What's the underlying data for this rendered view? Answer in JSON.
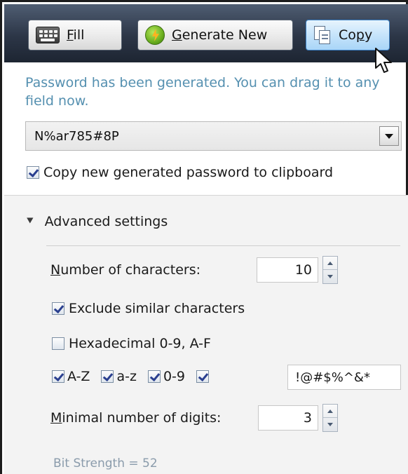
{
  "toolbar": {
    "fill": {
      "label_pre": "",
      "label_ul": "F",
      "label_post": "ill",
      "icon": "keyboard-icon"
    },
    "generate": {
      "label_pre": "",
      "label_ul": "G",
      "label_post": "enerate New",
      "icon": "lightning-icon"
    },
    "copy": {
      "label_pre": "Co",
      "label_ul": "p",
      "label_post": "y",
      "icon": "copy-icon"
    }
  },
  "info_text": "Password has been generated. You can drag it to any field now.",
  "password": {
    "value": "N%ar785#8P"
  },
  "copy_to_clipboard": {
    "label": "Copy new generated password to clipboard",
    "checked": true
  },
  "advanced": {
    "header": "Advanced settings",
    "num_chars": {
      "label_ul": "N",
      "label_rest": "umber of characters:",
      "value": "10"
    },
    "exclude_similar": {
      "label": "Exclude similar characters",
      "checked": true
    },
    "hexadecimal": {
      "label": "Hexadecimal 0-9, A-F",
      "checked": false
    },
    "sets": [
      {
        "label": "A-Z",
        "checked": true
      },
      {
        "label": "a-z",
        "checked": true
      },
      {
        "label": "0-9",
        "checked": true
      },
      {
        "label": "",
        "checked": true
      }
    ],
    "symbols": "!@#$%^&*",
    "min_digits": {
      "label_ul": "M",
      "label_rest": "inimal number of digits:",
      "value": "3"
    },
    "bit_strength": "Bit Strength = 52"
  },
  "colors": {
    "toolbar": "#2c3647",
    "info_text": "#5590b0",
    "panel": "#f3f3f3"
  }
}
